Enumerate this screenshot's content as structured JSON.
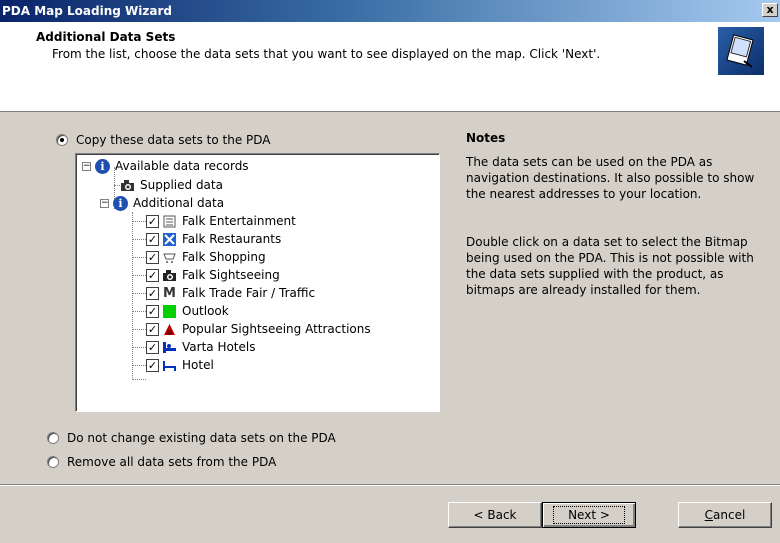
{
  "window": {
    "title": "PDA Map Loading Wizard",
    "close_label": "x"
  },
  "header": {
    "title": "Additional Data Sets",
    "subtitle": "From the list, choose the data sets that you want to see displayed on the map. Click 'Next'."
  },
  "options": {
    "copy": "Copy these data sets to the PDA",
    "no_change": "Do not change existing data sets on the PDA",
    "remove": "Remove all data sets from the PDA",
    "selected": "copy"
  },
  "tree": {
    "root": "Available data records",
    "supplied": "Supplied data",
    "additional": "Additional data",
    "items": [
      {
        "label": "Falk Entertainment",
        "icon": "entertainment-icon",
        "checked": true
      },
      {
        "label": "Falk Restaurants",
        "icon": "restaurant-icon",
        "checked": true
      },
      {
        "label": "Falk Shopping",
        "icon": "shopping-icon",
        "checked": true
      },
      {
        "label": "Falk Sightseeing",
        "icon": "sightseeing-icon",
        "checked": true
      },
      {
        "label": "Falk Trade Fair / Traffic",
        "icon": "trade-fair-icon",
        "checked": true
      },
      {
        "label": "Outlook",
        "icon": "outlook-green-icon",
        "checked": true
      },
      {
        "label": "Popular Sightseeing Attractions",
        "icon": "attractions-icon",
        "checked": true
      },
      {
        "label": "Varta Hotels",
        "icon": "varta-hotel-icon",
        "checked": true
      },
      {
        "label": "Hotel",
        "icon": "hotel-bed-icon",
        "checked": true
      }
    ]
  },
  "notes": {
    "title": "Notes",
    "p1": "The data sets can be used on the PDA as navigation destinations. It also possible to show the nearest addresses to your location.",
    "p2": "Double click on a data set to select the Bitmap being used on the PDA. This is not possible with the data sets supplied with the product, as bitmaps are already installed for them."
  },
  "buttons": {
    "back": "< Back",
    "next": "Next >",
    "cancel_first": "C",
    "cancel_rest": "ancel"
  },
  "colors": {
    "titlebar_start": "#0a246a",
    "dialog_bg": "#d4d0c8",
    "info_blue": "#1f4fb0"
  }
}
